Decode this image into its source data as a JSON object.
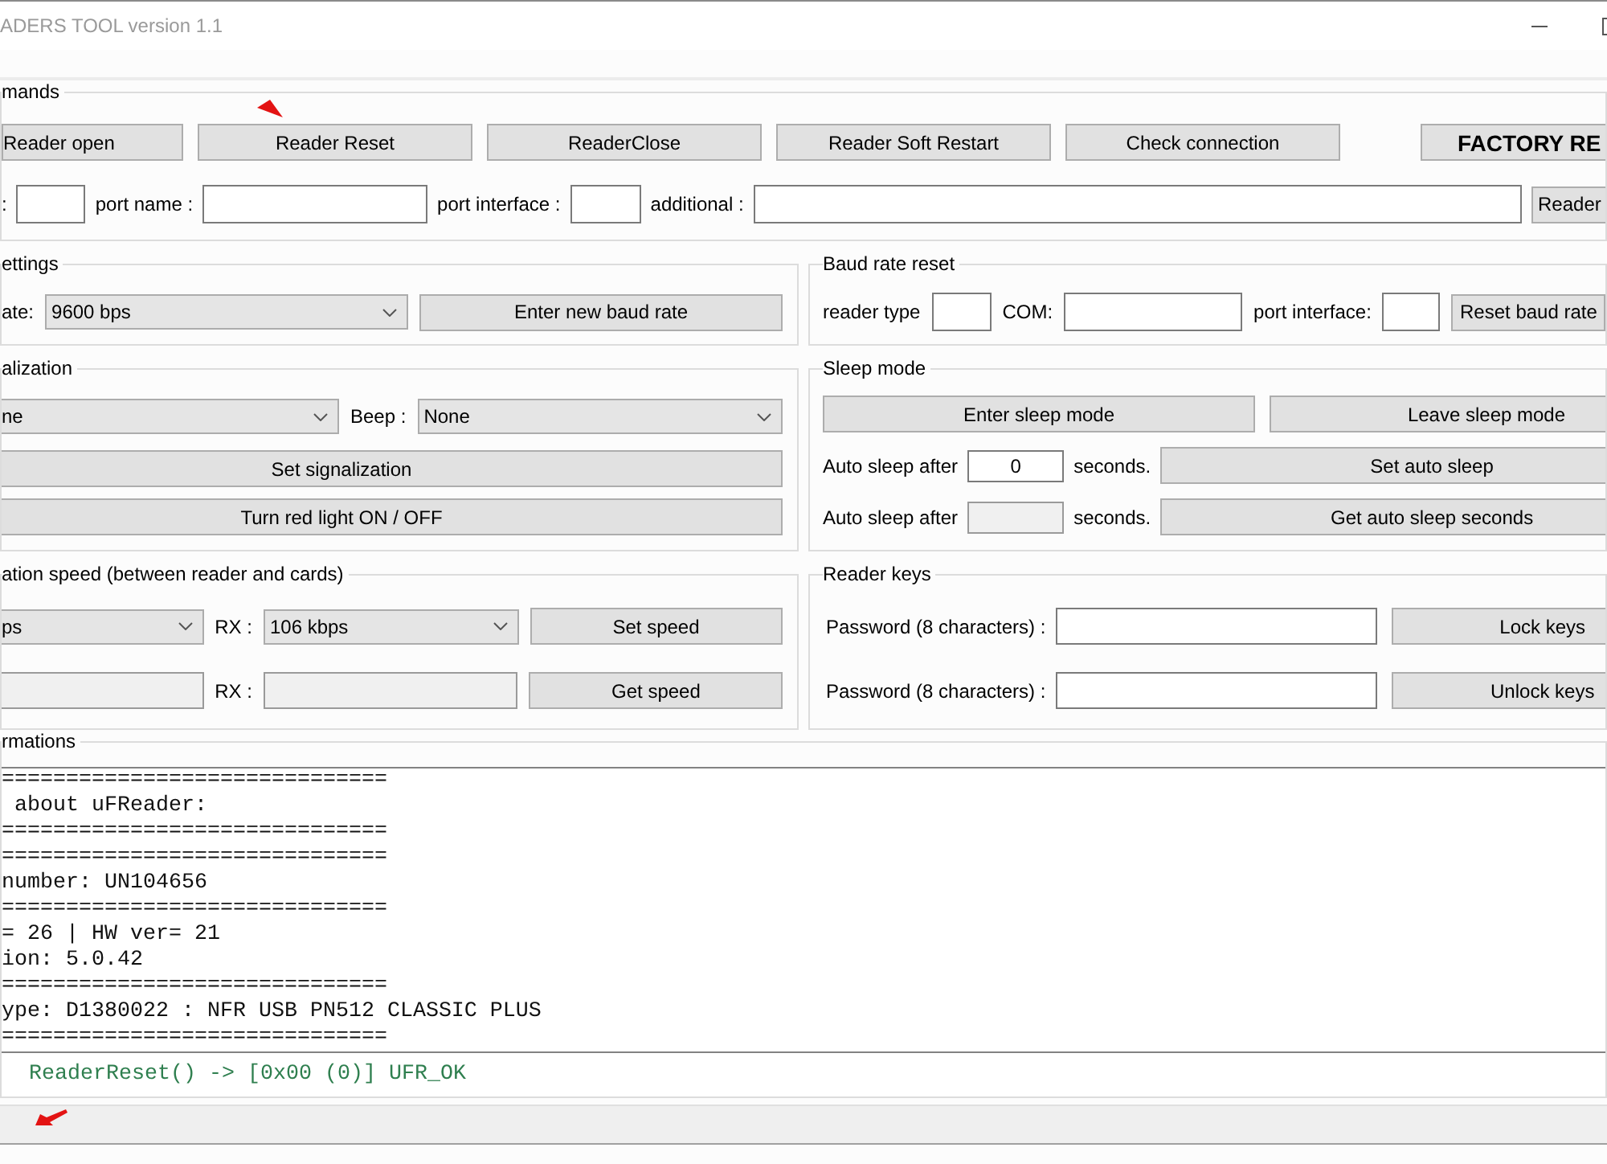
{
  "window": {
    "title": "ADERS TOOL version 1.1"
  },
  "commands": {
    "title": "mands",
    "buttons": [
      {
        "label": "Reader open"
      },
      {
        "label": "Reader Reset"
      },
      {
        "label": "ReaderClose"
      },
      {
        "label": "Reader Soft Restart"
      },
      {
        "label": "Check connection"
      }
    ],
    "factory_button": "FACTORY RE",
    "fields": [
      {
        "label": ":"
      },
      {
        "label": "port name :"
      },
      {
        "label": "port interface :"
      },
      {
        "label": "additional :"
      }
    ],
    "reader_button": "Reader"
  },
  "baud_settings": {
    "title": "ettings",
    "rate_label": "ate:",
    "rate_select": "9600 bps",
    "button": "Enter new baud rate"
  },
  "baud_reset": {
    "title": "Baud rate reset",
    "fields": [
      {
        "label": "reader type"
      },
      {
        "label": "COM:"
      },
      {
        "label": "port interface:"
      }
    ],
    "button": "Reset baud rate"
  },
  "signalization": {
    "title": "alization",
    "light_select": "ne",
    "beep_label": "Beep :",
    "beep_select": "None",
    "buttons": [
      "Set signalization",
      "Turn red light ON / OFF"
    ]
  },
  "sleep_mode": {
    "title": "Sleep mode",
    "buttons": [
      "Enter sleep mode",
      "Leave sleep mode"
    ],
    "rows": [
      {
        "label": "Auto sleep after",
        "value": "0",
        "readonly": false,
        "unit": "seconds.",
        "button": "Set auto sleep"
      },
      {
        "label": "Auto sleep after",
        "readonly": true,
        "unit": "seconds.",
        "button": "Get auto sleep seconds"
      }
    ]
  },
  "speed": {
    "title": "ation speed (between reader and cards)",
    "rows": [
      {
        "kind": "select",
        "tx": "ps",
        "rx_label": "RX :",
        "rx": "106 kbps",
        "button": "Set speed"
      },
      {
        "kind": "readout",
        "rx_label": "RX :",
        "button": "Get speed"
      }
    ]
  },
  "reader_keys": {
    "title": "Reader keys",
    "rows": [
      {
        "label": "Password (8 characters) :",
        "button": "Lock keys"
      },
      {
        "label": "Password (8 characters) :",
        "button": "Unlock keys"
      }
    ]
  },
  "informations": {
    "title": "rmations",
    "log": [
      "==============================",
      " about uFReader:",
      "==============================",
      "==============================",
      "number: UN104656",
      "==============================",
      "= 26 | HW ver= 21",
      "ion: 5.0.42",
      "==============================",
      "ype: D1380022 : NFR USB PN512 CLASSIC PLUS",
      "=============================="
    ],
    "status": "ReaderReset() -> [0x00 (0)] UFR_OK"
  }
}
